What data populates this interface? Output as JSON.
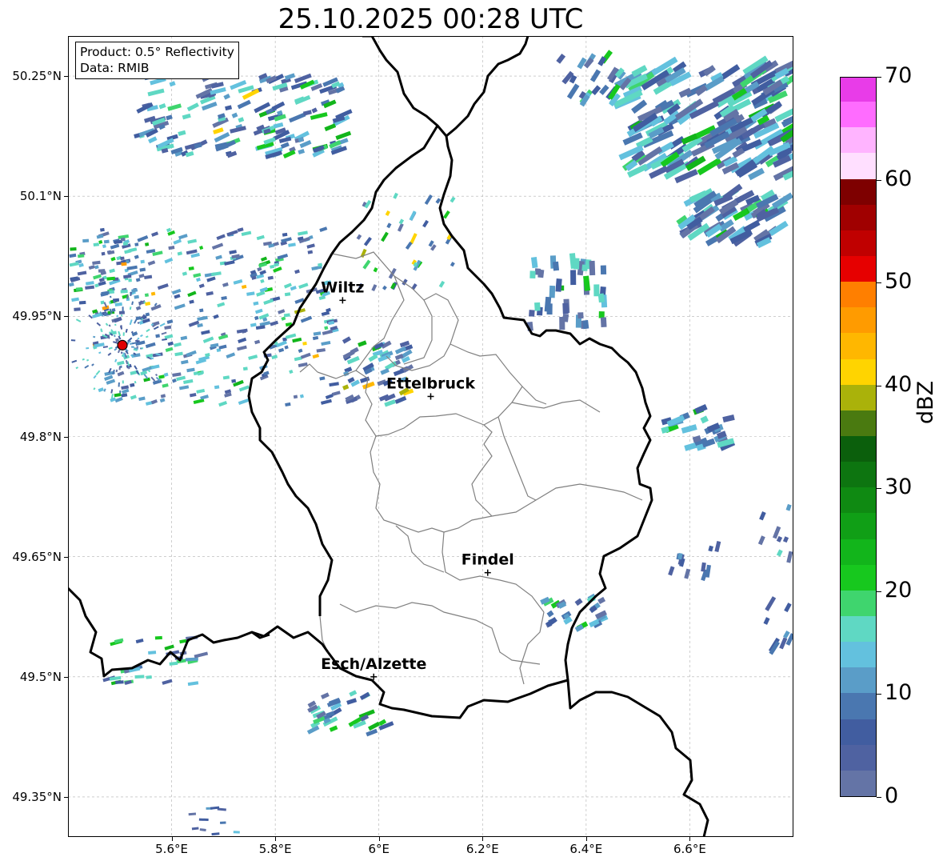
{
  "title": "25.10.2025 00:28 UTC",
  "info": {
    "product": "Product: 0.5° Reflectivity",
    "data": "Data: RMIB"
  },
  "axes": {
    "lat_ticks": [
      "50.25°N",
      "50.1°N",
      "49.95°N",
      "49.8°N",
      "49.65°N",
      "49.5°N",
      "49.35°N"
    ],
    "lon_ticks": [
      "5.6°E",
      "5.8°E",
      "6°E",
      "6.2°E",
      "6.4°E",
      "6.6°E"
    ],
    "lat_values": [
      50.25,
      50.1,
      49.95,
      49.8,
      49.65,
      49.5,
      49.35
    ],
    "lon_values": [
      5.6,
      5.8,
      6.0,
      6.2,
      6.4,
      6.6
    ],
    "lat_range": [
      49.3,
      50.3
    ],
    "lon_range": [
      5.4,
      6.8
    ],
    "grid": true
  },
  "cities": [
    {
      "name": "Wiltz",
      "lat": 49.97,
      "lon": 5.93
    },
    {
      "name": "Ettelbruck",
      "lat": 49.85,
      "lon": 6.1
    },
    {
      "name": "Findel",
      "lat": 49.63,
      "lon": 6.21
    },
    {
      "name": "Esch/Alzette",
      "lat": 49.5,
      "lon": 5.99
    }
  ],
  "radar_site": {
    "lat": 49.914,
    "lon": 5.505,
    "color": "#e00000"
  },
  "colorbar": {
    "label": "dBZ",
    "min": 0,
    "max": 70,
    "step": 2.5,
    "tick_labels": [
      "0",
      "10",
      "20",
      "30",
      "40",
      "50",
      "60",
      "70"
    ],
    "tick_values": [
      0,
      10,
      20,
      30,
      40,
      50,
      60,
      70
    ],
    "colors": [
      "#6474a6",
      "#4f62a1",
      "#415da0",
      "#4a77b0",
      "#5a9dc8",
      "#63c1de",
      "#5fd8c3",
      "#3fd56e",
      "#17c81e",
      "#12b51b",
      "#109f16",
      "#0f8a12",
      "#0d7510",
      "#0b5f0c",
      "#4a7a10",
      "#aab20a",
      "#ffd400",
      "#ffb700",
      "#ff9b00",
      "#ff7f00",
      "#e60000",
      "#c00000",
      "#a00000",
      "#7e0000",
      "#ffdfff",
      "#ffb4ff",
      "#ff6cff",
      "#e83ce8"
    ]
  },
  "colors": {
    "border_country": "#000000",
    "border_canton": "#808080",
    "grid": "#b0b0b0"
  }
}
